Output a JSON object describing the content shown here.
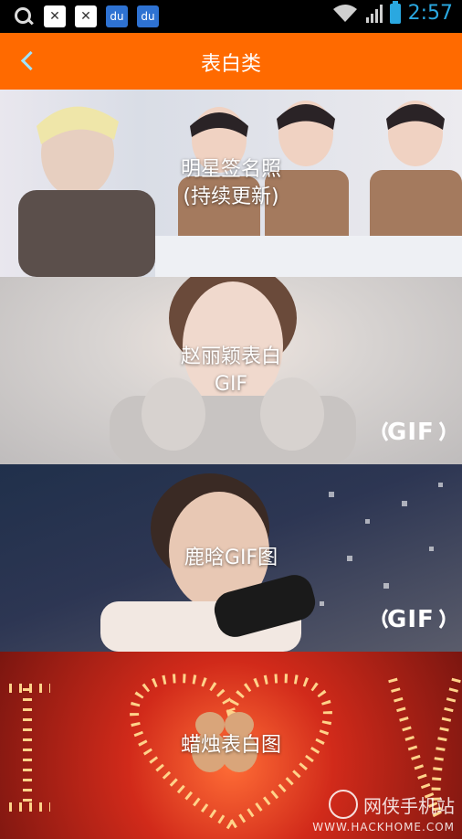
{
  "status_bar": {
    "time": "2:57",
    "icons": [
      "search-icon",
      "notification-icon",
      "notification-icon",
      "baidu-paw-icon",
      "baidu-paw-icon",
      "wifi-icon",
      "signal-icon",
      "battery-icon"
    ]
  },
  "app_bar": {
    "title": "表白类",
    "back_icon": "chevron-left-icon",
    "bg_color": "#ff6a00"
  },
  "cards": [
    {
      "label_line1": "明星签名照",
      "label_line2": "(持续更新)",
      "gif": false
    },
    {
      "label_line1": "赵丽颖表白",
      "label_line2": "GIF",
      "gif": true,
      "badge": "GIF"
    },
    {
      "label_line1": "鹿晗GIF图",
      "label_line2": "",
      "gif": true,
      "badge": "GIF"
    },
    {
      "label_line1": "蜡烛表白图",
      "label_line2": "",
      "gif": false
    }
  ],
  "watermark": {
    "name": "网侠手机站",
    "url": "WWW.HACKHOME.COM"
  }
}
